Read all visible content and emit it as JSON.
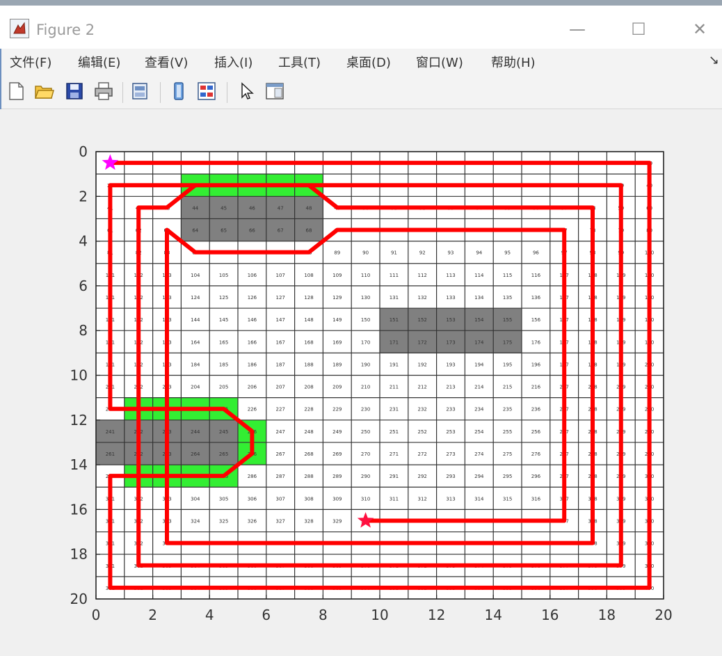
{
  "window": {
    "title": "Figure 2",
    "minimize_glyph": "—",
    "maximize_glyph": "☐",
    "close_glyph": "✕"
  },
  "menu": {
    "items": [
      "文件(F)",
      "编辑(E)",
      "查看(V)",
      "插入(I)",
      "工具(T)",
      "桌面(D)",
      "窗口(W)",
      "帮助(H)"
    ],
    "overflow": "↘"
  },
  "toolbar": {
    "buttons": [
      "new-figure-icon",
      "open-file-icon",
      "save-icon",
      "print-icon",
      "print-preview-icon",
      "link-plot-icon",
      "insert-colorbar-icon",
      "pointer-icon",
      "property-editor-icon"
    ]
  },
  "colors": {
    "path": "#ff0000",
    "obstacle": "#808080",
    "buffer": "#33ee33",
    "grid": "#333333",
    "start_marker": "#ff00ff",
    "end_marker": "#ff1040"
  },
  "chart_data": {
    "type": "coverage-path-grid",
    "grid_size": [
      20,
      20
    ],
    "xlim": [
      0,
      20
    ],
    "ylim": [
      0,
      20
    ],
    "y_axis_reversed": true,
    "xticks": [
      "0",
      "2",
      "4",
      "6",
      "8",
      "10",
      "12",
      "14",
      "16",
      "18",
      "20"
    ],
    "yticks": [
      "0",
      "2",
      "4",
      "6",
      "8",
      "10",
      "12",
      "14",
      "16",
      "18",
      "20"
    ],
    "cell_labels": "row-major index 1–400 (row*20 + col + 1)",
    "obstacles": [
      {
        "x": [
          3,
          8
        ],
        "y": [
          2,
          4
        ]
      },
      {
        "x": [
          10,
          15
        ],
        "y": [
          7,
          9
        ]
      },
      {
        "x": [
          0,
          5
        ],
        "y": [
          12,
          14
        ]
      }
    ],
    "buffers": [
      {
        "x": [
          3,
          8
        ],
        "y": [
          1,
          2
        ]
      },
      {
        "x": [
          1,
          5
        ],
        "y": [
          11,
          15
        ]
      },
      {
        "x": [
          5,
          6
        ],
        "y": [
          12,
          14
        ]
      }
    ],
    "start": {
      "x": 0.5,
      "y": 0.5
    },
    "end": {
      "x": 9.5,
      "y": 16.5
    },
    "path": [
      [
        0.5,
        0.5
      ],
      [
        19.5,
        0.5
      ],
      [
        19.5,
        19.5
      ],
      [
        0.5,
        19.5
      ],
      [
        0.5,
        14.5
      ],
      [
        4.5,
        14.5
      ],
      [
        5.5,
        13.5
      ],
      [
        5.5,
        12.5
      ],
      [
        4.5,
        11.5
      ],
      [
        0.5,
        11.5
      ],
      [
        0.5,
        1.5
      ],
      [
        18.5,
        1.5
      ],
      [
        18.5,
        18.5
      ],
      [
        1.5,
        18.5
      ],
      [
        1.5,
        14.5
      ],
      [
        1.5,
        11.5
      ],
      [
        1.5,
        2.5
      ],
      [
        2.5,
        2.5
      ],
      [
        3.5,
        1.5
      ],
      [
        7.5,
        1.5
      ],
      [
        8.5,
        2.5
      ],
      [
        17.5,
        2.5
      ],
      [
        17.5,
        17.5
      ],
      [
        2.5,
        17.5
      ],
      [
        2.5,
        14.5
      ],
      [
        2.5,
        11.5
      ],
      [
        2.5,
        3.5
      ],
      [
        3.5,
        4.5
      ],
      [
        7.5,
        4.5
      ],
      [
        8.5,
        3.5
      ],
      [
        16.5,
        3.5
      ],
      [
        16.5,
        16.5
      ],
      [
        9.5,
        16.5
      ]
    ]
  }
}
